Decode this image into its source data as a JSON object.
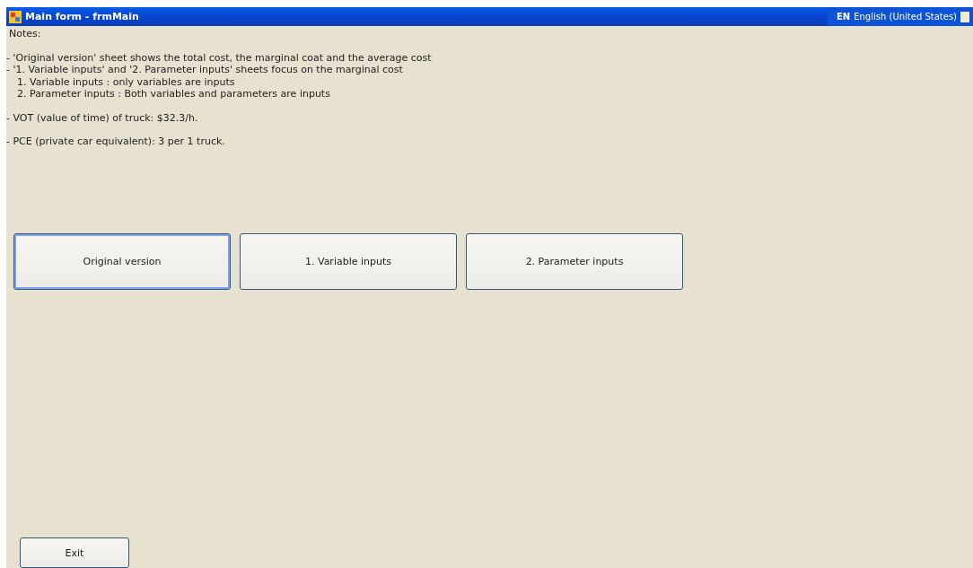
{
  "window": {
    "title": "Main form - frmMain"
  },
  "language_bar": {
    "code": "EN",
    "language": "English (United States)"
  },
  "notes": {
    "heading": "Notes:",
    "groups": [
      [
        {
          "text": "-  'Original version' sheet shows the total cost, the marginal coat and the average cost"
        },
        {
          "text": "-  '1. Variable inputs' and '2. Parameter inputs' sheets focus on the marginal cost",
          "children": [
            {
              "text": "1. Variable inputs : only variables are inputs"
            },
            {
              "text": "2. Parameter inputs : Both variables and parameters are inputs"
            }
          ]
        }
      ],
      [
        {
          "text": "- VOT (value of time) of truck: $32.3/h."
        }
      ],
      [
        {
          "text": "- PCE (private car equivalent): 3 per 1 truck."
        }
      ]
    ]
  },
  "buttons": [
    {
      "label": "Original version",
      "focused": true
    },
    {
      "label": "1. Variable inputs",
      "focused": false
    },
    {
      "label": "2. Parameter inputs",
      "focused": false
    }
  ],
  "exit_button": {
    "label": "Exit"
  }
}
